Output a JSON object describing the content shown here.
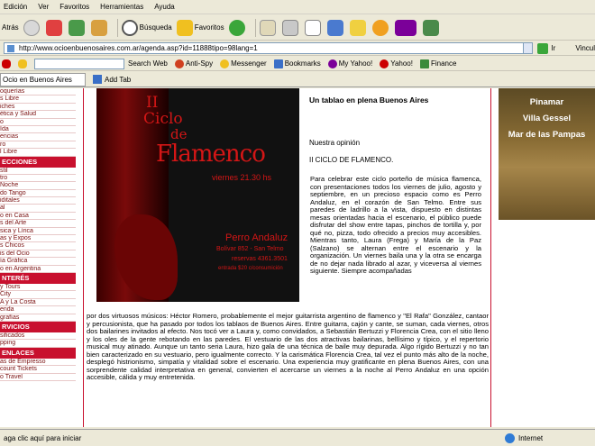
{
  "menu": [
    "Edición",
    "Ver",
    "Favoritos",
    "Herramientas",
    "Ayuda"
  ],
  "toolbar": {
    "back": "Atrás",
    "search": "Búsqueda",
    "favorites": "Favoritos"
  },
  "address": {
    "url": "http://www.ocioenbuenosaires.com.ar/agenda.asp?id=11888tipo=98lang=1",
    "go": "Ir",
    "links": "Vincul"
  },
  "yahoo": {
    "search_web": "Search Web",
    "anti_spy": "Anti-Spy",
    "messenger": "Messenger",
    "bookmarks": "Bookmarks",
    "my_yahoo": "My Yahoo!",
    "yahoo": "Yahoo!",
    "finance": "Finance"
  },
  "tab": {
    "title": "Ocio en Buenos Aires",
    "add": "Add Tab"
  },
  "sidebar": {
    "group1": [
      "oquerías",
      "s Libre",
      "iches",
      "ética y Salud",
      "o",
      "Ida",
      "encias",
      "ro",
      "l Libre"
    ],
    "head1": "ECCIONES",
    "group2": [
      "stil",
      "tro",
      "Noche",
      "do Tango",
      "iditales",
      "al",
      "o en Casa",
      "s del Arte",
      "sica y Lírica",
      "as y Expos",
      "s Chicos",
      "is del Ocio",
      "ía Gráfica",
      "o en Argentina"
    ],
    "head2": "NTERÉS",
    "group3": [
      "y Tours",
      "City",
      "A y La Costa",
      "enda",
      "grafías"
    ],
    "head3": "RVICIOS",
    "group4": [
      "sificados",
      "pping"
    ],
    "head4": "ENLACES",
    "group5": [
      "as de Empresso",
      "count Tickets",
      "o Travel"
    ]
  },
  "article": {
    "title": "Un tablao en plena Buenos Aires",
    "opinion": "Nuestra opinión",
    "subtitle": "II CICLO DE FLAMENCO.",
    "para1": "Para celebrar este ciclo porteño de música flamenca, con presentaciones todos los viernes de julio, agosto y septiembre, en un precioso espacio como es Perro Andaluz, en el corazón de San Telmo. Entre sus paredes de ladrillo a la vista, dispuesto en distintas mesas orientadas hacia el escenario, el público puede disfrutar del show entre tapas, pinchos de tortilla y, por qué no, pizza, todo ofrecido a precios muy accesibles. Mientras tanto, Laura (Frega) y María de la Paz (Salzano) se alternan entre el escenario y la organización. Un viernes baila una y la otra se encarga de no dejar nada librado al azar, y viceversa al viernes siguiente. Siempre acompañadas",
    "para2": "por dos virtuosos músicos: Héctor Romero, probablemente el mejor guitarrista argentino de flamenco y \"El Rafa\" González, cantaor y percusionista, que ha pasado por todos los tablaos de Buenos Aires. Entre guitarra, cajón y cante, se suman, cada viernes, otros dos bailarines invitados al efecto. Nos tocó ver a Laura y, como convidados, a Sebastián Bertuzzi y Florencia Crea, con el sitio lleno y los oles de la gente rebotando en las paredes. El vestuario de las dos atractivas bailarinas, bellísimo y típico, y el repertorio musical muy atinado. Aunque un tanto seria Laura, hizo gala de una técnica de baile muy depurada. Algo rígido Bertuzzi y no tan bien caracterizado en su vestuario, pero igualmente correcto. Y la carismática Florencia Crea, tal vez el punto más alto de la noche, desplegó histrionismo, simpatía y vitalidad sobre el escenario. Una experiencia muy gratificante en plena Buenos Aires, con una sorprendente calidad interpretativa en general, convierten el acercarse un viernes a la noche al Perro Andaluz en una opción accesible, cálida y muy entretenida."
  },
  "poster": {
    "l1": "II",
    "l2": "Ciclo",
    "l3": "de",
    "l4": "Flamenco",
    "l5": "viernes 21.30 hs",
    "l6": "Perro Andaluz",
    "l7": "Bolívar 852 - San Telmo",
    "l8": "reservas 4361.3501",
    "l9": "entrada $20 c/consumición"
  },
  "ad": {
    "c1": "Pinamar",
    "c2": "Villa Gessel",
    "c3": "Mar de las Pampas"
  },
  "status": {
    "text": "aga clic aquí para iniciar",
    "zone": "Internet"
  }
}
